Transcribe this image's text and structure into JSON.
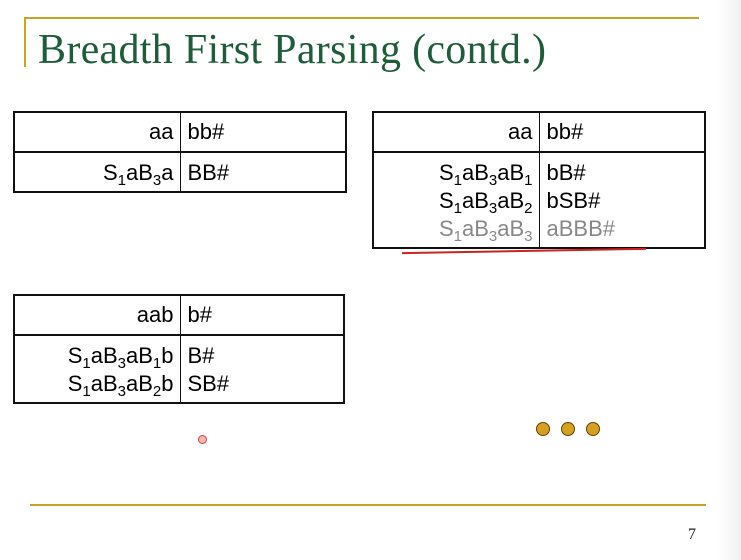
{
  "slide": {
    "title": "Breadth First Parsing (contd.)",
    "page_number": "7",
    "colors": {
      "title": "#1e5c3a",
      "accent_rule": "#c9a227",
      "strike": "#cc2222",
      "dots": "#d6a21e"
    }
  },
  "table_top_left": {
    "header": {
      "consumed": "aa",
      "remaining": "bb#"
    },
    "rows": [
      {
        "form": [
          "S",
          "1",
          "aB",
          "3",
          "a"
        ],
        "remaining": "BB#"
      }
    ]
  },
  "table_top_right": {
    "header": {
      "consumed": "aa",
      "remaining": "bb#"
    },
    "rows": [
      {
        "form": [
          "S",
          "1",
          "aB",
          "3",
          "aB",
          "1"
        ],
        "remaining": "bB#"
      },
      {
        "form": [
          "S",
          "1",
          "aB",
          "3",
          "aB",
          "2"
        ],
        "remaining": "bSB#"
      },
      {
        "form": [
          "S",
          "1",
          "aB",
          "3",
          "aB",
          "3"
        ],
        "remaining": "aBBB#",
        "struck_out": true
      }
    ]
  },
  "table_bottom_left": {
    "header": {
      "consumed": "aab",
      "remaining": "b#"
    },
    "rows": [
      {
        "form": [
          "S",
          "1",
          "aB",
          "3",
          "aB",
          "1",
          "b"
        ],
        "remaining": "B#"
      },
      {
        "form": [
          "S",
          "1",
          "aB",
          "3",
          "aB",
          "2",
          "b"
        ],
        "remaining": "SB#"
      }
    ]
  },
  "ellipsis": {
    "dot_count": 3,
    "icon": "ellipsis-dots"
  }
}
